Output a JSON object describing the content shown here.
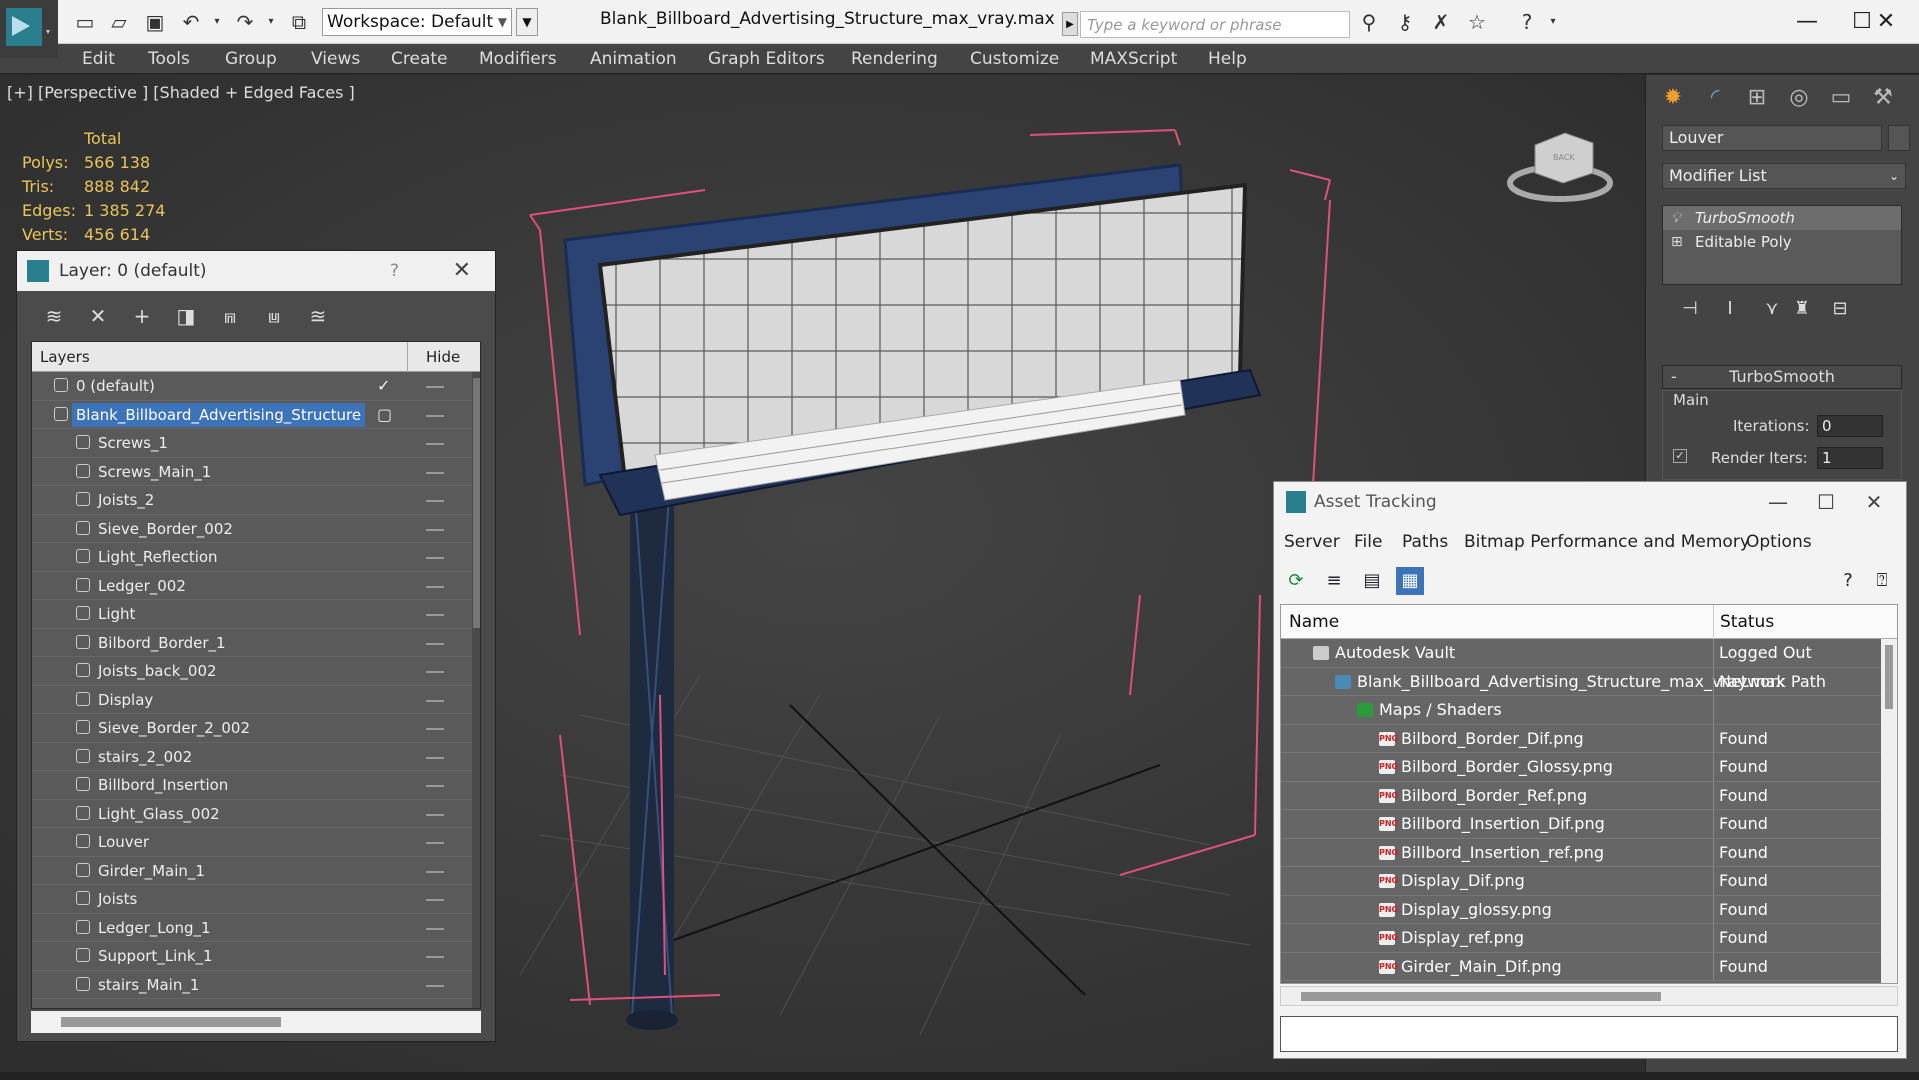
{
  "titlebar": {
    "workspace_label": "Workspace: Default",
    "document_title": "Blank_Billboard_Advertising_Structure_max_vray.max",
    "search_placeholder": "Type a keyword or phrase"
  },
  "menu": [
    "Edit",
    "Tools",
    "Group",
    "Views",
    "Create",
    "Modifiers",
    "Animation",
    "Graph Editors",
    "Rendering",
    "Customize",
    "MAXScript",
    "Help"
  ],
  "viewport": {
    "label": "[+] [Perspective ] [Shaded + Edged Faces ]",
    "stats": {
      "header": "Total",
      "polys_label": "Polys:",
      "polys": "566 138",
      "tris_label": "Tris:",
      "tris": "888 842",
      "edges_label": "Edges:",
      "edges": "1 385 274",
      "verts_label": "Verts:",
      "verts": "456 614"
    },
    "viewcube_label": "BACK"
  },
  "command_panel": {
    "object_name": "Louver",
    "modifier_list": "Modifier List",
    "stack": [
      "TurboSmooth",
      "Editable Poly"
    ],
    "rollout_title": "TurboSmooth",
    "group_main": "Main",
    "iterations_label": "Iterations:",
    "iterations_value": "0",
    "render_iters_label": "Render Iters:",
    "render_iters_value": "1",
    "collapse_sign": "-"
  },
  "layer_explorer": {
    "title": "Layer: 0 (default)",
    "help": "?",
    "col_layers": "Layers",
    "col_hide": "Hide",
    "rows": [
      {
        "name": "0 (default)",
        "level": 0
      },
      {
        "name": "Blank_Billboard_Advertising_Structure",
        "level": 0
      },
      {
        "name": "Screws_1",
        "level": 1
      },
      {
        "name": "Screws_Main_1",
        "level": 1
      },
      {
        "name": "Joists_2",
        "level": 1
      },
      {
        "name": "Sieve_Border_002",
        "level": 1
      },
      {
        "name": "Light_Reflection",
        "level": 1
      },
      {
        "name": "Ledger_002",
        "level": 1
      },
      {
        "name": "Light",
        "level": 1
      },
      {
        "name": "Bilbord_Border_1",
        "level": 1
      },
      {
        "name": "Joists_back_002",
        "level": 1
      },
      {
        "name": "Display",
        "level": 1
      },
      {
        "name": "Sieve_Border_2_002",
        "level": 1
      },
      {
        "name": "stairs_2_002",
        "level": 1
      },
      {
        "name": "Billbord_Insertion",
        "level": 1
      },
      {
        "name": "Light_Glass_002",
        "level": 1
      },
      {
        "name": "Louver",
        "level": 1
      },
      {
        "name": "Girder_Main_1",
        "level": 1
      },
      {
        "name": "Joists",
        "level": 1
      },
      {
        "name": "Ledger_Long_1",
        "level": 1
      },
      {
        "name": "Support_Link_1",
        "level": 1
      },
      {
        "name": "stairs_Main_1",
        "level": 1
      }
    ]
  },
  "asset_tracking": {
    "title": "Asset Tracking",
    "menu": [
      "Server",
      "File",
      "Paths",
      "Bitmap Performance and Memory",
      "Options"
    ],
    "col_name": "Name",
    "col_status": "Status",
    "rows": [
      {
        "name": "Autodesk Vault",
        "status": "Logged Out",
        "indent": 1,
        "icon": "vault"
      },
      {
        "name": "Blank_Billboard_Advertising_Structure_max_vray.max",
        "status": "Network Path",
        "indent": 2,
        "icon": "max"
      },
      {
        "name": "Maps / Shaders",
        "status": "",
        "indent": 3,
        "icon": "folder"
      },
      {
        "name": "Bilbord_Border_Dif.png",
        "status": "Found",
        "indent": 4,
        "icon": "png"
      },
      {
        "name": "Bilbord_Border_Glossy.png",
        "status": "Found",
        "indent": 4,
        "icon": "png"
      },
      {
        "name": "Bilbord_Border_Ref.png",
        "status": "Found",
        "indent": 4,
        "icon": "png"
      },
      {
        "name": "Billbord_Insertion_Dif.png",
        "status": "Found",
        "indent": 4,
        "icon": "png"
      },
      {
        "name": "Billbord_Insertion_ref.png",
        "status": "Found",
        "indent": 4,
        "icon": "png"
      },
      {
        "name": "Display_Dif.png",
        "status": "Found",
        "indent": 4,
        "icon": "png"
      },
      {
        "name": "Display_glossy.png",
        "status": "Found",
        "indent": 4,
        "icon": "png"
      },
      {
        "name": "Display_ref.png",
        "status": "Found",
        "indent": 4,
        "icon": "png"
      },
      {
        "name": "Girder_Main_Dif.png",
        "status": "Found",
        "indent": 4,
        "icon": "png"
      }
    ],
    "png_badge": "PNG"
  },
  "colors": {
    "accent": "#3d73b8",
    "stats": "#e8c65a",
    "selection_box": "#e0507a"
  }
}
